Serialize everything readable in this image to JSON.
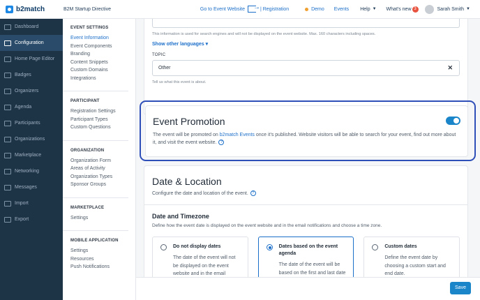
{
  "topbar": {
    "logo": "b2match",
    "event_name": "B2M Startup Directive",
    "goto_label": "Go to Event Website",
    "registration_label": "| Registration",
    "demo_label": "Demo",
    "events_label": "Events",
    "help_label": "Help",
    "whats_new_label": "What's new",
    "whats_new_count": "3",
    "user_name": "Sarah Smith",
    "accent": "#1c6fc9"
  },
  "sidebar": {
    "items": [
      {
        "label": "Dashboard",
        "icon": "dashboard-icon"
      },
      {
        "label": "Configuration",
        "icon": "gear-icon"
      },
      {
        "label": "Home Page Editor",
        "icon": "editor-icon"
      },
      {
        "label": "Badges",
        "icon": "badge-icon"
      },
      {
        "label": "Organizers",
        "icon": "organizers-icon"
      },
      {
        "label": "Agenda",
        "icon": "calendar-icon"
      },
      {
        "label": "Participants",
        "icon": "participants-icon"
      },
      {
        "label": "Organizations",
        "icon": "organizations-icon"
      },
      {
        "label": "Marketplace",
        "icon": "marketplace-icon"
      },
      {
        "label": "Networking",
        "icon": "networking-icon"
      },
      {
        "label": "Messages",
        "icon": "messages-icon"
      },
      {
        "label": "Import",
        "icon": "import-icon"
      },
      {
        "label": "Export",
        "icon": "export-icon"
      }
    ]
  },
  "submenu": {
    "event_settings": {
      "title": "EVENT SETTINGS",
      "links": [
        "Event Information",
        "Event Components",
        "Branding",
        "Content Snippets",
        "Custom Domains",
        "Integrations"
      ]
    },
    "participant": {
      "title": "PARTICIPANT",
      "links": [
        "Registration Settings",
        "Participant Types",
        "Custom Questions"
      ]
    },
    "organization": {
      "title": "ORGANIZATION",
      "links": [
        "Organization Form",
        "Areas of Activity",
        "Organization Types",
        "Sponsor Groups"
      ]
    },
    "marketplace": {
      "title": "MARKETPLACE",
      "links": [
        "Settings"
      ]
    },
    "mobile": {
      "title": "MOBILE APPLICATION",
      "links": [
        "Settings",
        "Resources",
        "Push Notifications"
      ]
    }
  },
  "main": {
    "seo_hint": "This information is used for search engines and will not be displayed on the event website. Max. 160 characters including spaces.",
    "show_other_languages": "Show other languages ▾",
    "topic_label": "TOPIC",
    "topic_value": "Other",
    "topic_hint": "Tell us what this event is about.",
    "promotion": {
      "title": "Event Promotion",
      "text_before": "The event will be promoted on ",
      "link": "b2match Events",
      "text_after": " once it's published. Website visitors will be able to search for your event, find out more about it, and visit the event website.",
      "enabled": true
    },
    "date_location": {
      "title": "Date & Location",
      "subtitle": "Configure the date and location of the event.",
      "timezone_title": "Date and Timezone",
      "timezone_sub": "Define how the event date is displayed on the event website and in the email notifications and choose a time zone.",
      "options": [
        {
          "label": "Do not display dates",
          "desc": "The date of the event will not be displayed on the event website and in the email",
          "selected": false
        },
        {
          "label": "Dates based on the event agenda",
          "desc": "The date of the event will be based on the first and last date",
          "selected": true
        },
        {
          "label": "Custom dates",
          "desc": "Define the event date by choosing a custom start and end date.",
          "selected": false
        }
      ]
    }
  },
  "footer": {
    "save_label": "Save"
  }
}
